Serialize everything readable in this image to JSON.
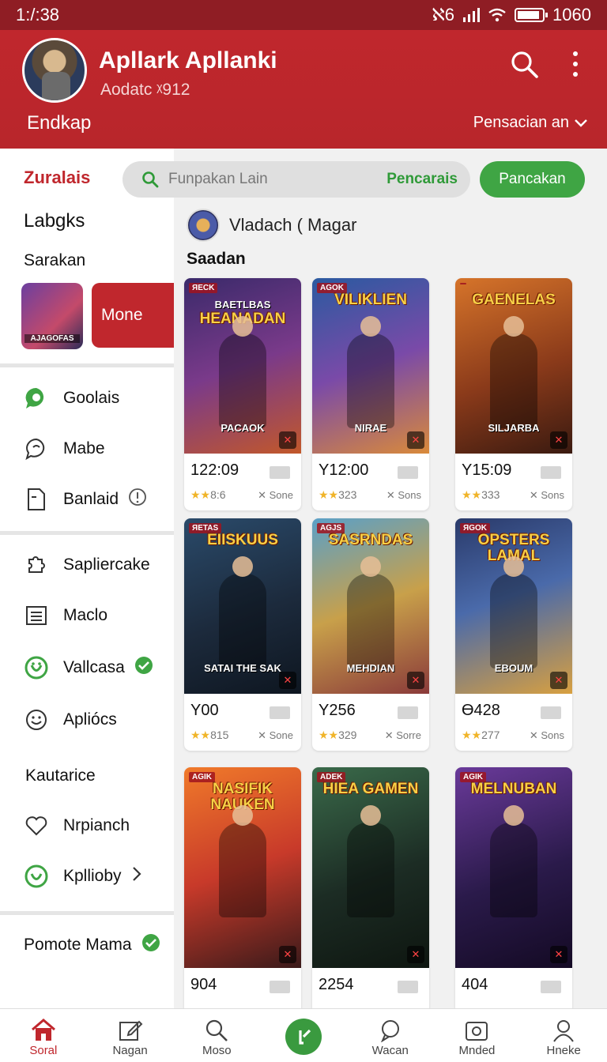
{
  "status_bar": {
    "time": "1:/:38",
    "network": "ℵ6",
    "battery": "1060",
    "battery_level": 0.9
  },
  "header": {
    "app_title": "Apllark Apllanki",
    "app_subtitle": "Aodatc ᵡ912",
    "left_label": "Endkap",
    "right_label": "Pensacian an"
  },
  "sidebar": {
    "brand": "Zuralais",
    "heading": "Labgks",
    "subheading": "Sarakan",
    "thumb_tag": "AJAGOFAS",
    "more_label": "Mone",
    "group1": [
      {
        "label": "Goolais",
        "icon": "chat-bubble-icon"
      },
      {
        "label": "Mabe",
        "icon": "message-icon"
      },
      {
        "label": "Banlaid",
        "icon": "document-icon",
        "trail": "info-icon"
      }
    ],
    "group2": [
      {
        "label": "Sapliercake",
        "icon": "puzzle-icon"
      },
      {
        "label": "Maclo",
        "icon": "list-icon"
      },
      {
        "label": "Vallcasa",
        "icon": "android-icon",
        "trail": "verified-icon"
      },
      {
        "label": "Apliócs",
        "icon": "smiley-icon"
      }
    ],
    "section_label": "Kautarice",
    "group3": [
      {
        "label": "Nrpianch",
        "icon": "heart-icon"
      },
      {
        "label": "Kpllioby",
        "icon": "android-icon",
        "trail": "chevron-right-icon"
      }
    ],
    "footer_item": {
      "label": "Pomote Mama",
      "trail": "verified-icon"
    }
  },
  "search": {
    "placeholder": "Funpakan Lain",
    "action": "Pencarais",
    "button": "Pancakan"
  },
  "section": {
    "title": "Vladach ( Magar",
    "subtitle": "Saadan"
  },
  "cards": [
    {
      "badge": "ЯECK",
      "title": "HEANADAN",
      "title_top": "BAETLBAS",
      "subtitle": "PACAOK",
      "price": "122:09",
      "rating": "8:6",
      "meta": "Sone",
      "bg": "linear-gradient(160deg,#3a2a6a,#7a3a8a 50%,#c2582a)"
    },
    {
      "badge": "AGOK",
      "title": "VILIKLIEN",
      "title_top": "",
      "subtitle": "NIRAE",
      "price": "Y12:00",
      "rating": "323",
      "meta": "Sons",
      "bg": "linear-gradient(160deg,#2a5aa0,#7a4aa8 50%,#d98a3a)"
    },
    {
      "badge": "",
      "title": "GAENELAS",
      "title_top": "",
      "subtitle": "SILJARBA",
      "price": "Y15:09",
      "rating": "333",
      "meta": "Sons",
      "bg": "linear-gradient(160deg,#d6742a,#8a3a1a 55%,#3a1a10)"
    },
    {
      "badge": "ЯETAS",
      "title": "EIISKUUS",
      "title_top": "",
      "subtitle": "SATAI THE SAK",
      "price": "Y00",
      "rating": "815",
      "meta": "Sone",
      "bg": "linear-gradient(160deg,#2a4a6a,#1c2a3c 55%,#0e1620)"
    },
    {
      "badge": "AGJS",
      "title": "SASRNDAS",
      "title_top": "",
      "subtitle": "MEHDIAN",
      "price": "Y256",
      "rating": "329",
      "meta": "Sorre",
      "bg": "linear-gradient(160deg,#5aa0c8,#c8a04a 50%,#8a3a3a)"
    },
    {
      "badge": "ЯGOK",
      "title": "OPSTERS LAMAL",
      "title_top": "",
      "subtitle": "EBOUM",
      "price": "Ɵ428",
      "rating": "277",
      "meta": "Sons",
      "bg": "linear-gradient(160deg,#2a3a6a,#4a6aaa 45%,#d8a040)"
    },
    {
      "badge": "AGIK",
      "title": "NASIFIK NAUKEN",
      "title_top": "",
      "subtitle": "",
      "price": "904",
      "rating": "",
      "meta": "",
      "bg": "linear-gradient(160deg,#f07a2a,#c83a2a 50%,#3a1a1a)"
    },
    {
      "badge": "ADEK",
      "title": "HIEA GAMEN",
      "title_top": "",
      "subtitle": "",
      "price": "2254",
      "rating": "",
      "meta": "",
      "bg": "linear-gradient(160deg,#3a6a4a,#1c2c24 55%,#0e1610)"
    },
    {
      "badge": "AGIK",
      "title": "MELNUBAN",
      "title_top": "",
      "subtitle": "",
      "price": "404",
      "rating": "",
      "meta": "",
      "bg": "linear-gradient(160deg,#6a3a9a,#2a1a4a 55%,#140a24)"
    }
  ],
  "bottom_nav": [
    {
      "label": "Soral",
      "icon": "home-icon",
      "active": true
    },
    {
      "label": "Nagan",
      "icon": "edit-icon",
      "active": false
    },
    {
      "label": "Moso",
      "icon": "search-icon",
      "active": false
    },
    {
      "label": "",
      "icon": "add-icon",
      "active": false
    },
    {
      "label": "Wacan",
      "icon": "chat-icon",
      "active": false
    },
    {
      "label": "Mnded",
      "icon": "camera-icon",
      "active": false
    },
    {
      "label": "Hneke",
      "icon": "profile-icon",
      "active": false
    }
  ],
  "colors": {
    "brand_red": "#c0272d",
    "accent_green": "#3fa544",
    "star": "#f0b429"
  }
}
